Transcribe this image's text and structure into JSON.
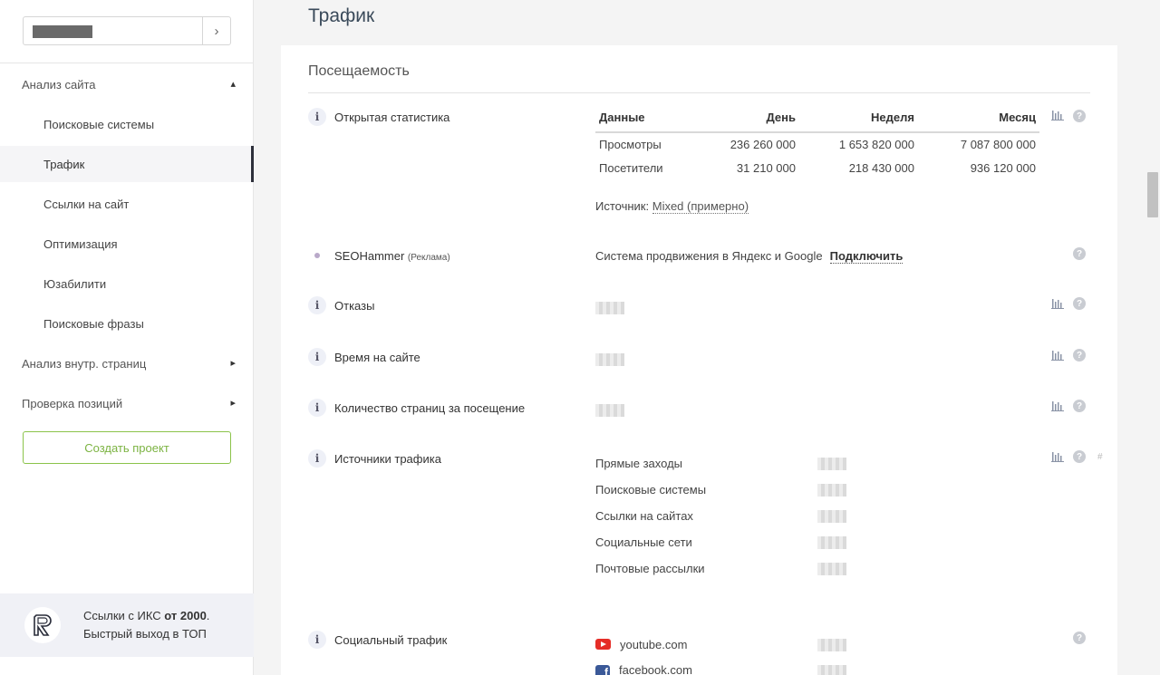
{
  "sidebar": {
    "search_go_icon": "chevron-right-icon",
    "nav": [
      {
        "label": "Анализ сайта",
        "chevron": "⌃"
      },
      {
        "label": "Поисковые системы"
      },
      {
        "label": "Трафик"
      },
      {
        "label": "Ссылки на сайт"
      },
      {
        "label": "Оптимизация"
      },
      {
        "label": "Юзабилити"
      },
      {
        "label": "Поисковые фразы"
      },
      {
        "label": "Анализ внутр. страниц",
        "chevron": "›"
      },
      {
        "label": "Проверка позиций",
        "chevron": "›"
      }
    ],
    "create_button": "Создать проект",
    "promo": {
      "line1_prefix": "Ссылки с ИКС",
      "line1_bold": "от 2000",
      "line1_suffix": ".",
      "line2": "Быстрый выход в ТОП"
    }
  },
  "main": {
    "page_title": "Трафик",
    "section_title": "Посещаемость",
    "rows": {
      "open_stats": "Открытая статистика",
      "seohammer": "SEOHammer",
      "seohammer_tag": "(Реклама)",
      "bounces": "Отказы",
      "time_on_site": "Время на сайте",
      "pages_per_visit": "Количество страниц за посещение",
      "traffic_sources": "Источники трафика",
      "social_traffic": "Социальный трафик"
    },
    "stats_table": {
      "headers": [
        "Данные",
        "День",
        "Неделя",
        "Месяц"
      ],
      "rows": [
        [
          "Просмотры",
          "236 260 000",
          "1 653 820 000",
          "7 087 800 000"
        ],
        [
          "Посетители",
          "31 210 000",
          "218 430 000",
          "936 120 000"
        ]
      ]
    },
    "source_label": "Источник:",
    "source_value": "Mixed (примерно)",
    "seohammer_text": "Система продвижения в Яндекс и Google",
    "seohammer_link": "Подключить",
    "traffic_sources": [
      "Прямые заходы",
      "Поисковые системы",
      "Ссылки на сайтах",
      "Социальные сети",
      "Почтовые рассылки"
    ],
    "social": [
      "youtube.com",
      "facebook.com"
    ],
    "icons": {
      "info": "i",
      "help": "?",
      "hash": "#"
    }
  }
}
